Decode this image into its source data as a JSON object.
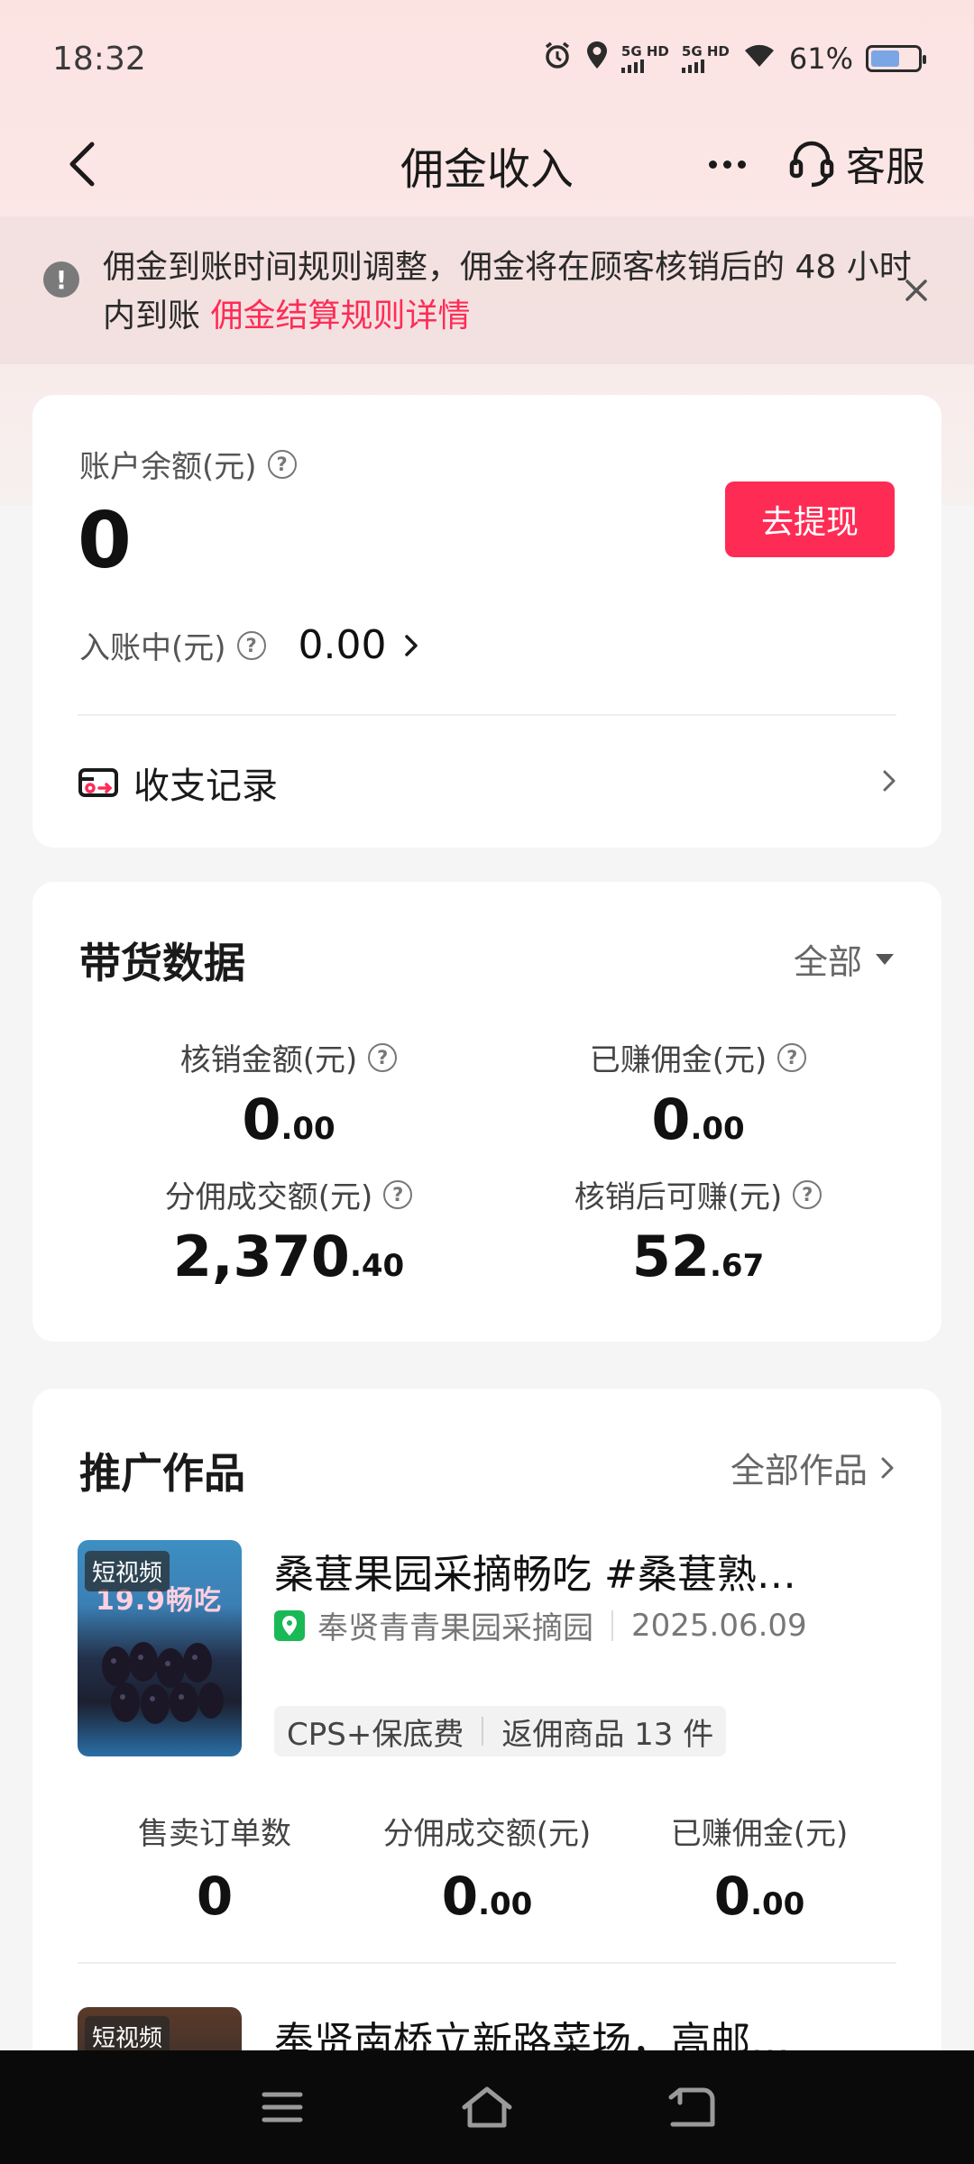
{
  "status_bar": {
    "time": "18:32",
    "network1": "5G HD",
    "network2": "5G HD",
    "battery_text": "61%",
    "battery_level": 0.61
  },
  "nav": {
    "title": "佣金收入",
    "service_label": "客服"
  },
  "notice": {
    "text": "佣金到账时间规则调整，佣金将在顾客核销后的 48 小时内到账",
    "link": "佣金结算规则详情"
  },
  "balance": {
    "label": "账户余额(元)",
    "value": "0",
    "withdraw_label": "去提现",
    "pending_label": "入账中(元)",
    "pending_value": "0.00",
    "records_label": "收支记录"
  },
  "sales": {
    "title": "带货数据",
    "filter": "全部",
    "stats": [
      {
        "label": "核销金额(元)",
        "int": "0",
        "dec": ".00"
      },
      {
        "label": "已赚佣金(元)",
        "int": "0",
        "dec": ".00"
      },
      {
        "label": "分佣成交额(元)",
        "int": "2,370",
        "dec": ".40"
      },
      {
        "label": "核销后可赚(元)",
        "int": "52",
        "dec": ".67"
      }
    ]
  },
  "works": {
    "title": "推广作品",
    "all_label": "全部作品",
    "items": [
      {
        "tag": "短视频",
        "thumb_text": "19.9畅吃",
        "title": "桑葚果园采摘畅吃 #桑葚熟…",
        "shop": "奉贤青青果园采摘园",
        "date": "2025.06.09",
        "tag1": "CPS+保底费",
        "tag2": "返佣商品 13 件",
        "stats": [
          {
            "label": "售卖订单数",
            "int": "0",
            "dec": ""
          },
          {
            "label": "分佣成交额(元)",
            "int": "0",
            "dec": ".00"
          },
          {
            "label": "已赚佣金(元)",
            "int": "0",
            "dec": ".00"
          }
        ]
      },
      {
        "tag": "短视频",
        "title": "奉贤南桥立新路菜场，高邮…"
      }
    ]
  }
}
